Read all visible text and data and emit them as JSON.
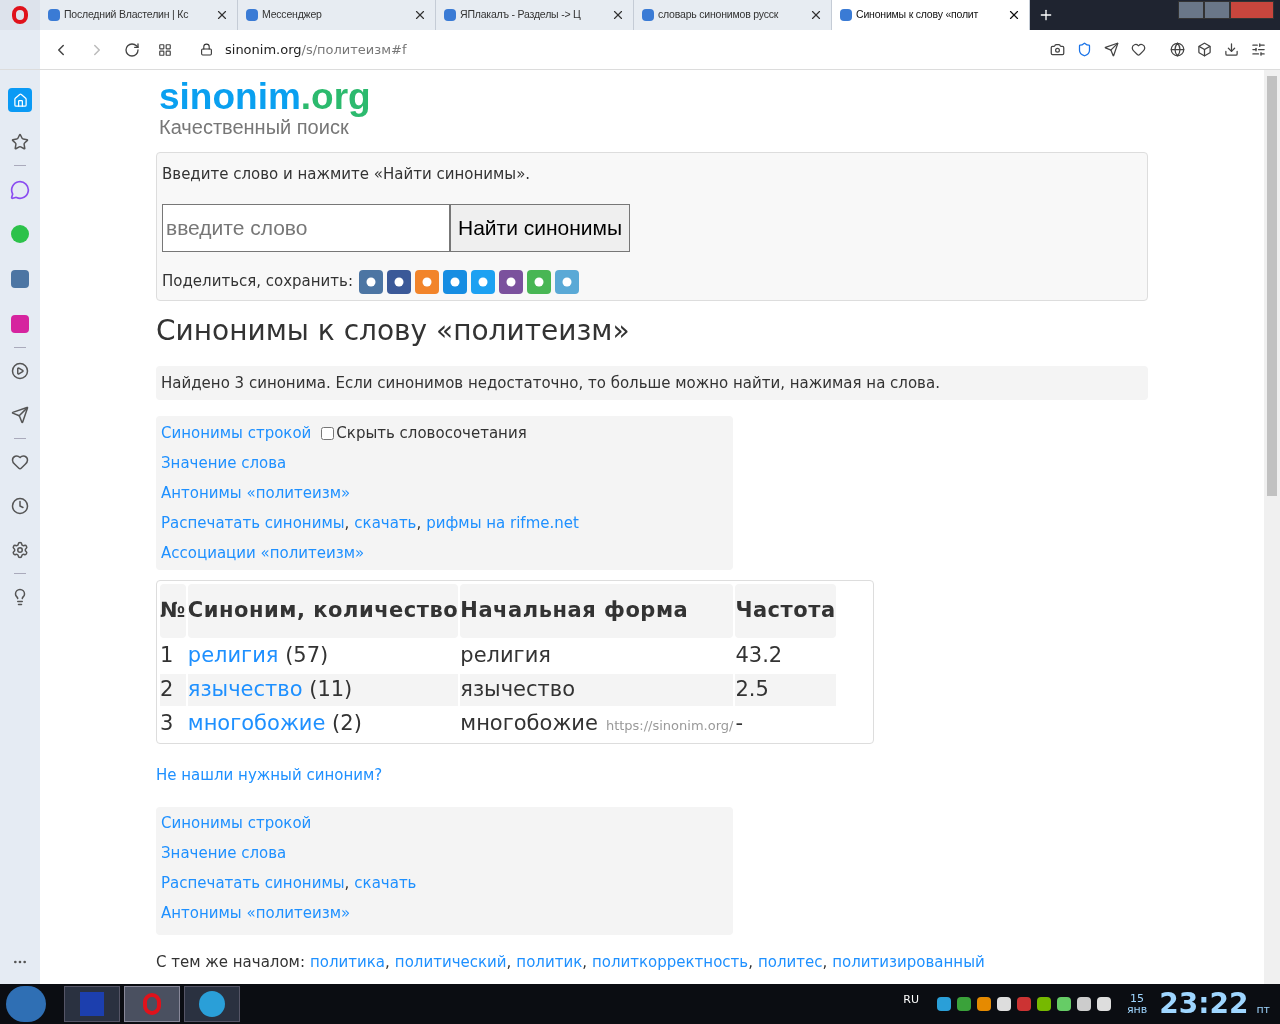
{
  "browser": {
    "tabs": [
      {
        "title": "Последний Властелин | Кс",
        "selected": false
      },
      {
        "title": "Мессенджер",
        "selected": false
      },
      {
        "title": "ЯПлакалъ - Разделы -> Ц",
        "selected": false
      },
      {
        "title": "словарь синонимов русск",
        "selected": false
      },
      {
        "title": "Синонимы к слову «полит",
        "selected": true
      }
    ],
    "url_host": "sinonim.org",
    "url_path": "/s/политеизм#f"
  },
  "logo": {
    "name": "sinonim",
    "tld": ".org",
    "tagline": "Качественный поиск"
  },
  "search": {
    "prompt": "Введите слово и нажмите «Найти синонимы».",
    "placeholder": "введите слово",
    "button": "Найти синонимы",
    "share_label": "Поделиться, сохранить:",
    "share": [
      {
        "color": "#4c75a3"
      },
      {
        "color": "#3b5998"
      },
      {
        "color": "#f2842a"
      },
      {
        "color": "#168de2"
      },
      {
        "color": "#1da1f2"
      },
      {
        "color": "#7b519d"
      },
      {
        "color": "#48b654"
      },
      {
        "color": "#5aa9d6"
      }
    ]
  },
  "heading": "Синонимы к слову «политеизм»",
  "found": "Найдено 3 синонима. Если синонимов недостаточно, то больше можно найти, нажимая на слова.",
  "links_top": {
    "checkbox": {
      "label": "Скрыть словосочетания",
      "checked": false
    },
    "lines": [
      [
        "Синонимы строкой"
      ],
      [
        "Значение слова"
      ],
      [
        "Антонимы «политеизм»"
      ],
      [
        "Распечатать синонимы",
        ",",
        "скачать",
        ",",
        "рифмы на rifme.net"
      ],
      [
        "Ассоциации «политеизм»"
      ]
    ]
  },
  "table": {
    "columns": [
      "№",
      "Синоним, количество",
      "Начальная форма",
      "Частота"
    ],
    "rows": [
      {
        "n": "1",
        "word": "религия",
        "count": "(57)",
        "form": "религия",
        "freq": "43.2"
      },
      {
        "n": "2",
        "word": "язычество",
        "count": "(11)",
        "form": "язычество",
        "freq": "2.5"
      },
      {
        "n": "3",
        "word": "многобожие",
        "count": "(2)",
        "form": "многобожие",
        "note": "https://sinonim.org/",
        "freq": "-"
      }
    ]
  },
  "not_found_link": "Не нашли нужный синоним?",
  "links_bottom": [
    [
      "Синонимы строкой"
    ],
    [
      "Значение слова"
    ],
    [
      "Распечатать синонимы",
      ",",
      "скачать"
    ],
    [
      "Антонимы «политеизм»"
    ]
  ],
  "same_start": {
    "label": "С тем же началом:",
    "links": [
      "политика",
      ",",
      "политический",
      ",",
      "политик",
      ",",
      "политкорректность",
      ",",
      "политес",
      ",",
      "политизированный"
    ]
  },
  "taskbar": {
    "lang": "RU",
    "day": "15",
    "month": "янв",
    "time": "23:22",
    "weekday": "пт"
  }
}
